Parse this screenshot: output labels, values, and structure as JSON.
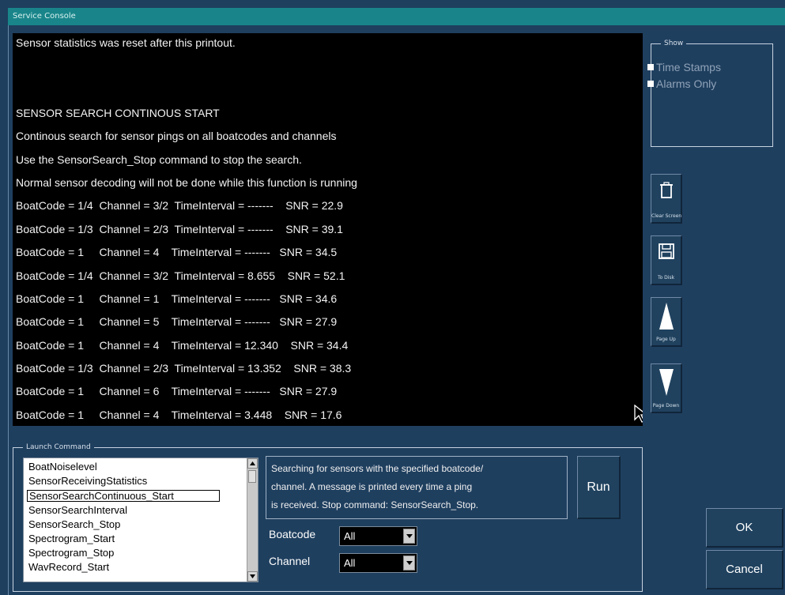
{
  "window": {
    "title": "Service Console"
  },
  "console": {
    "lines": [
      "Sensor statistics was reset after this printout.",
      "",
      "",
      "SENSOR SEARCH CONTINOUS START",
      "Continous search for sensor pings on all boatcodes and channels",
      "Use the SensorSearch_Stop command to stop the search.",
      "Normal sensor decoding will not be done while this function is running",
      "BoatCode = 1/4  Channel = 3/2  TimeInterval = -------    SNR = 22.9",
      "BoatCode = 1/3  Channel = 2/3  TimeInterval = -------    SNR = 39.1",
      "BoatCode = 1     Channel = 4    TimeInterval = -------   SNR = 34.5",
      "BoatCode = 1/4  Channel = 3/2  TimeInterval = 8.655    SNR = 52.1",
      "BoatCode = 1     Channel = 1    TimeInterval = -------   SNR = 34.6",
      "BoatCode = 1     Channel = 5    TimeInterval = -------   SNR = 27.9",
      "BoatCode = 1     Channel = 4    TimeInterval = 12.340    SNR = 34.4",
      "BoatCode = 1/3  Channel = 2/3  TimeInterval = 13.352    SNR = 38.3",
      "BoatCode = 1     Channel = 6    TimeInterval = -------   SNR = 27.9",
      "BoatCode = 1     Channel = 4    TimeInterval = 3.448    SNR = 17.6"
    ]
  },
  "show_panel": {
    "legend": "Show",
    "options": [
      {
        "label": "Time Stamps",
        "checked": true
      },
      {
        "label": "Alarms Only",
        "checked": true
      }
    ]
  },
  "toolbar": {
    "clear_screen": "Clear Screen",
    "to_disk": "To Disk",
    "page_up": "Page Up",
    "page_down": "Page Down"
  },
  "launch_panel": {
    "legend": "Launch Command",
    "commands": [
      "BoatNoiselevel",
      "SensorReceivingStatistics",
      "SensorSearchContinuous_Start",
      "SensorSearchInterval",
      "SensorSearch_Stop",
      "Spectrogram_Start",
      "Spectrogram_Stop",
      "WavRecord_Start"
    ],
    "selected_index": 2,
    "description": [
      "Searching for sensors with the specified boatcode/",
      "channel. A message is printed every time a ping",
      "is received. Stop command: SensorSearch_Stop."
    ],
    "run_label": "Run",
    "boatcode_label": "Boatcode",
    "boatcode_value": "All",
    "channel_label": "Channel",
    "channel_value": "All"
  },
  "dialog": {
    "ok_label": "OK",
    "cancel_label": "Cancel"
  }
}
